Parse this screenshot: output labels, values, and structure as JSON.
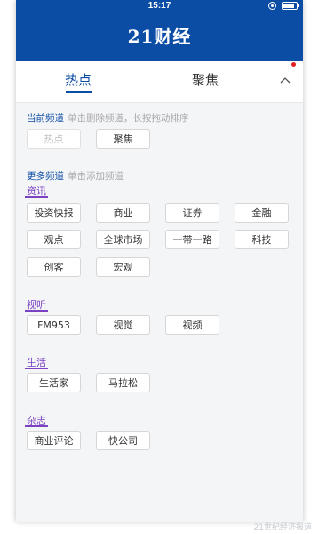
{
  "status_bar": {
    "time": "15:17"
  },
  "app": {
    "title": "21财经"
  },
  "tabs": {
    "hot": "热点",
    "focus": "聚焦"
  },
  "current_channels": {
    "label": "当前频道",
    "hint": "单击删除频道，长按拖动排序",
    "items": [
      "热点",
      "聚焦"
    ]
  },
  "more_channels": {
    "label": "更多频道",
    "hint": "单击添加频道",
    "categories": [
      {
        "name": "资讯",
        "items": [
          "投资快报",
          "商业",
          "证券",
          "金融",
          "观点",
          "全球市场",
          "一带一路",
          "科技",
          "创客",
          "宏观"
        ]
      },
      {
        "name": "视听",
        "items": [
          "FM953",
          "视觉",
          "视频"
        ]
      },
      {
        "name": "生活",
        "items": [
          "生活家",
          "马拉松"
        ]
      },
      {
        "name": "杂志",
        "items": [
          "商业评论",
          "快公司"
        ]
      }
    ]
  },
  "watermark": "21世纪经济报道",
  "colors": {
    "brand": "#0b4ca5",
    "category": "#7b42c2",
    "badge": "#e02020"
  }
}
